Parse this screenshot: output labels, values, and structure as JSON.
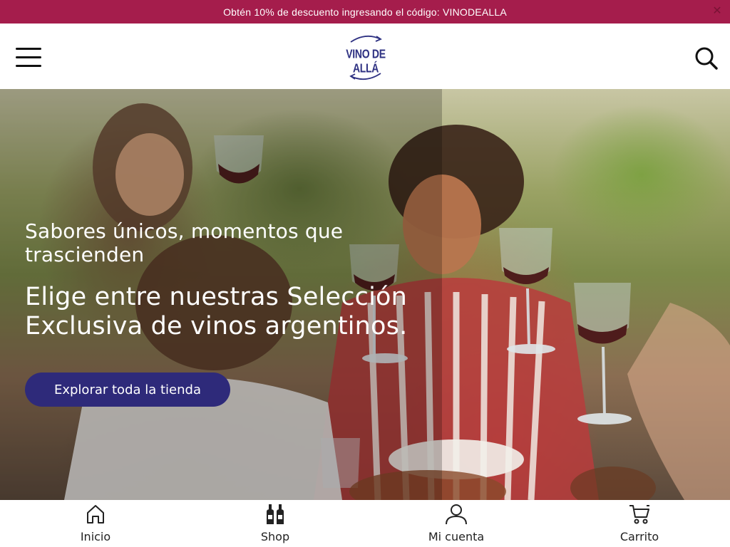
{
  "announcement": {
    "text": "Obtén 10% de descuento ingresando el código: VINODEALLA",
    "close_icon": "close-icon"
  },
  "header": {
    "menu_icon": "hamburger-menu-icon",
    "logo_text": "VINO DE ALLÁ",
    "search_icon": "search-icon"
  },
  "hero": {
    "subtitle": "Sabores únicos, momentos que trascienden",
    "title": "Elige entre nuestras Selección Exclusiva de vinos argentinos.",
    "cta_label": "Explorar toda la tienda"
  },
  "bottom_nav": {
    "items": [
      {
        "label": "Inicio",
        "icon": "home-icon"
      },
      {
        "label": "Shop",
        "icon": "wine-bottles-icon"
      },
      {
        "label": "Mi cuenta",
        "icon": "user-icon"
      },
      {
        "label": "Carrito",
        "icon": "cart-icon"
      }
    ]
  },
  "colors": {
    "announcement_bg": "#a51d4c",
    "brand": "#2e3182",
    "cta_bg": "#2e2a7a"
  }
}
